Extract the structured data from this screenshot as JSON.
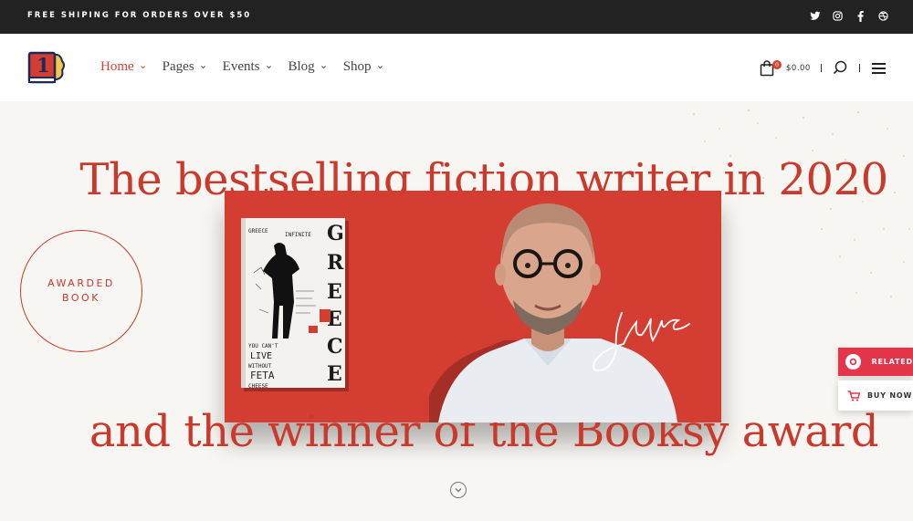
{
  "topbar": {
    "promo": "FREE SHIPING FOR ORDERS OVER $50",
    "social": [
      "twitter-icon",
      "instagram-icon",
      "facebook-icon",
      "dribbble-icon"
    ]
  },
  "logo": {
    "text": "1"
  },
  "nav": {
    "items": [
      {
        "label": "Home",
        "active": true
      },
      {
        "label": "Pages"
      },
      {
        "label": "Events"
      },
      {
        "label": "Blog"
      },
      {
        "label": "Shop"
      }
    ]
  },
  "cart": {
    "count": "0",
    "total": "$0.00"
  },
  "hero": {
    "headline_top": "The bestselling fiction writer in 2020",
    "headline_bottom": "and the winner of the Booksy award",
    "award_line1": "AWARDED",
    "award_line2": "BOOK",
    "book_title": "GREECE",
    "book_text": [
      "GREECE",
      "INFINITE",
      "YOU CAN'T",
      "LIVE",
      "WITHOUT",
      "FETA",
      "CHEESE"
    ]
  },
  "side": {
    "related": "RELATED",
    "buy_now": "BUY NOW"
  },
  "colors": {
    "accent": "#d44334",
    "panel": "#d43d31",
    "side": "#e4354b"
  }
}
